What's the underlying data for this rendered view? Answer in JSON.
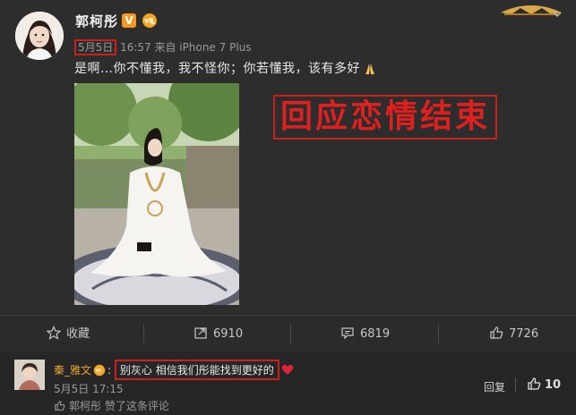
{
  "post": {
    "username": "郭柯彤",
    "verified_badge": "V",
    "date": "5月5日",
    "time_device": " 16:57 来自 iPhone 7 Plus",
    "text": "是啊…你不懂我，我不怪你；你若懂我，该有多好",
    "overlay_text": "回应恋情结束",
    "icons": {
      "vip": "vip-badge-icon",
      "crown": "crown-icon",
      "menu": "chevron-down-icon",
      "pray": "pray-hands-icon"
    }
  },
  "actions": {
    "favorite": "收藏",
    "repost": "6910",
    "comment": "6819",
    "like": "7726"
  },
  "comment": {
    "username": "秦_雅文",
    "text": "别灰心 相信我们彤能找到更好的",
    "time": "5月5日 17:15",
    "liked_by": "郭柯彤 赞了这条评论",
    "reply": "回复",
    "likes": "10"
  },
  "colors": {
    "background": "#2b2b2b",
    "highlight_red": "#c8211d",
    "overlay_red": "#e01f1f",
    "username_orange": "#e8a52e"
  }
}
